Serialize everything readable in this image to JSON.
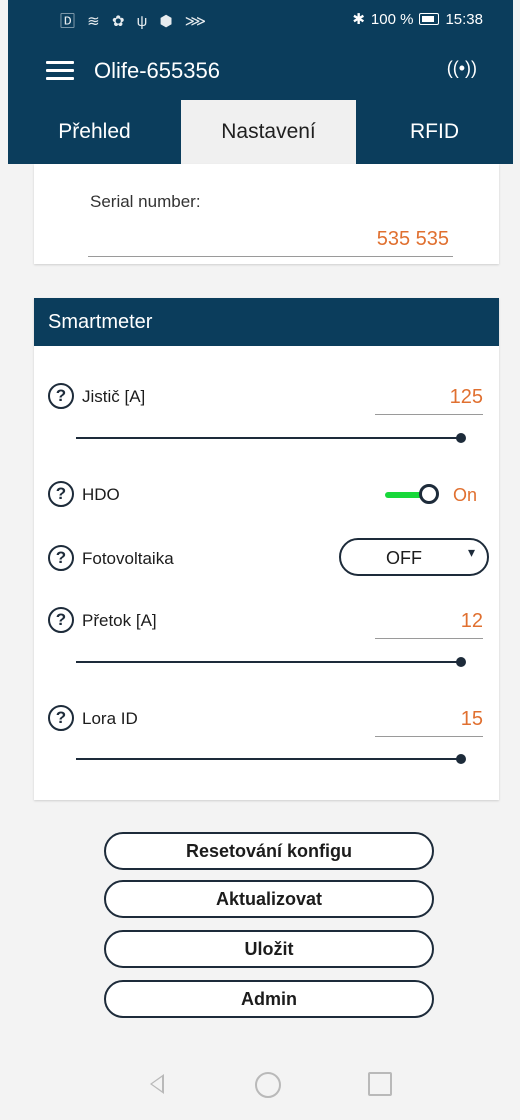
{
  "status_bar": {
    "left_icons": "🄳 ≋ ✿ ψ ⬢ ⋙",
    "bt": "✱",
    "battery_percent": "100 %",
    "time": "15:38"
  },
  "app_bar": {
    "title": "Olife-655356",
    "wifi_icon": "((•))"
  },
  "tabs": [
    {
      "label": "Přehled",
      "active": false
    },
    {
      "label": "Nastavení",
      "active": true
    },
    {
      "label": "RFID",
      "active": false
    }
  ],
  "serial": {
    "label": "Serial number:",
    "value": "535 535"
  },
  "smartmeter": {
    "header": "Smartmeter",
    "jistic": {
      "label": "Jistič [A]",
      "value": "125",
      "level": 1.0
    },
    "hdo": {
      "label": "HDO",
      "state": "On"
    },
    "fotovoltaika": {
      "label": "Fotovoltaika",
      "selected": "OFF"
    },
    "pretok": {
      "label": "Přetok  [A]",
      "value": "12",
      "level": 1.0
    },
    "lora": {
      "label": "Lora ID",
      "value": "15",
      "level": 1.0
    }
  },
  "buttons": {
    "reset": "Resetování konfigu",
    "update": "Aktualizovat",
    "save": "Uložit",
    "admin": "Admin"
  },
  "colors": {
    "brand": "#0b3d5c",
    "accent_value": "#e07030",
    "toggle_on": "#18d83a"
  }
}
